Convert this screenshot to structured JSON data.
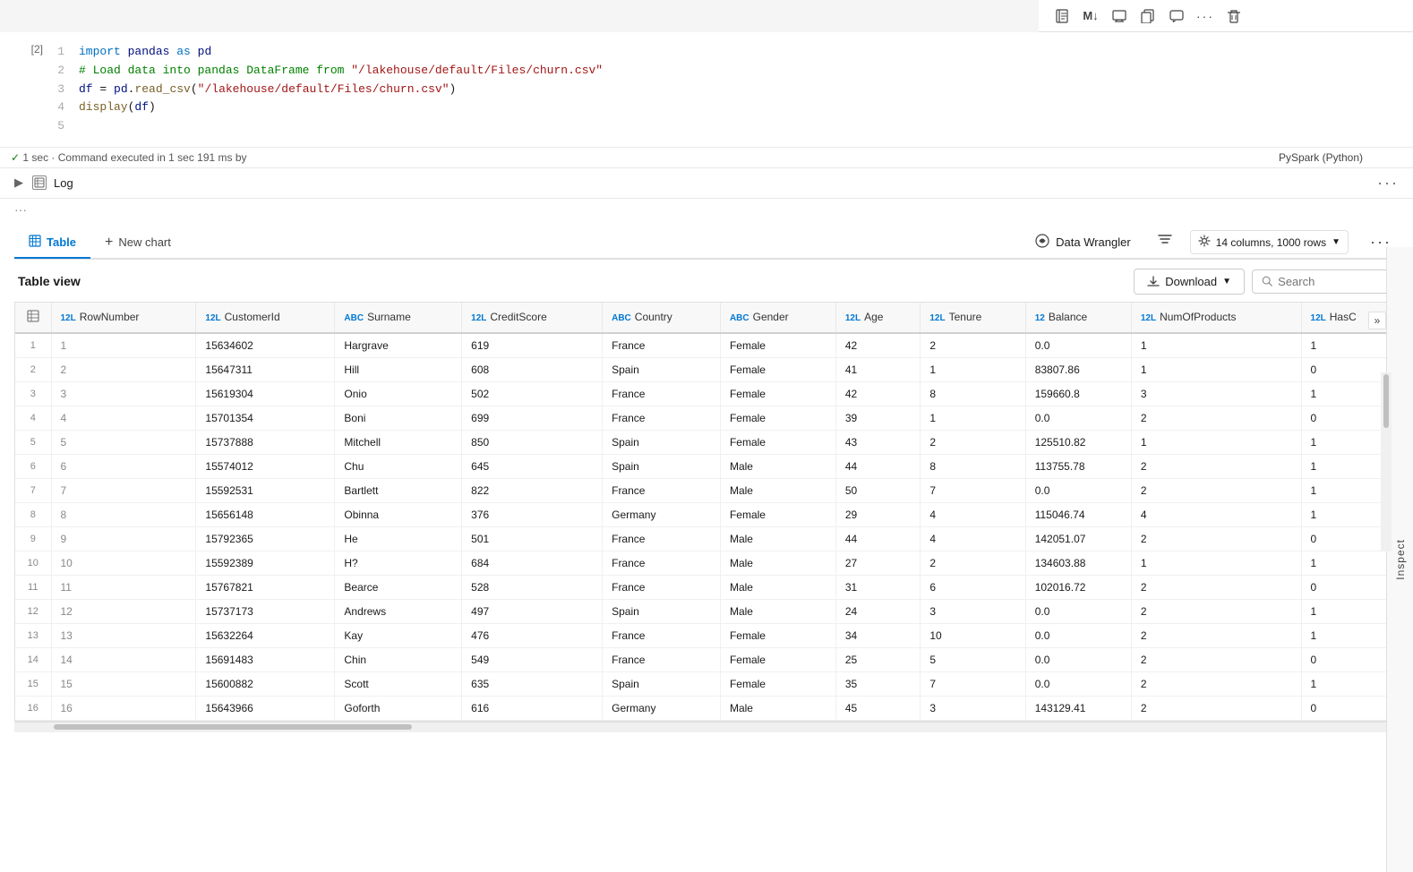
{
  "toolbar": {
    "buttons": [
      "notebook-icon",
      "markdown-icon",
      "screen-icon",
      "copy-icon",
      "comment-icon",
      "more-icon",
      "delete-icon"
    ]
  },
  "cell": {
    "exec_number": "[2]",
    "lines": [
      {
        "num": "1",
        "code": "import pandas as pd"
      },
      {
        "num": "2",
        "code": "# Load data into pandas DataFrame from \"/lakehouse/default/Files/churn.csv\""
      },
      {
        "num": "3",
        "code": "df = pd.read_csv(\"/lakehouse/default/Files/churn.csv\")"
      },
      {
        "num": "4",
        "code": "display(df)"
      },
      {
        "num": "5",
        "code": ""
      }
    ],
    "exec_status": "1 sec · Command executed in 1 sec 191 ms by",
    "exec_runtime": "PySpark (Python)"
  },
  "log": {
    "label": "Log"
  },
  "tabs": {
    "table_label": "Table",
    "new_chart_label": "New chart",
    "data_wrangler_label": "Data Wrangler",
    "col_config_label": "14 columns, 1000 rows",
    "table_view_title": "Table view",
    "download_label": "Download",
    "search_placeholder": "Search"
  },
  "table": {
    "columns": [
      {
        "type": "12L",
        "name": "RowNumber"
      },
      {
        "type": "12L",
        "name": "CustomerId"
      },
      {
        "type": "ABC",
        "name": "Surname"
      },
      {
        "type": "12L",
        "name": "CreditScore"
      },
      {
        "type": "ABC",
        "name": "Country"
      },
      {
        "type": "ABC",
        "name": "Gender"
      },
      {
        "type": "12L",
        "name": "Age"
      },
      {
        "type": "12L",
        "name": "Tenure"
      },
      {
        "type": "12",
        "name": "Balance"
      },
      {
        "type": "12L",
        "name": "NumOfProducts"
      },
      {
        "type": "12L",
        "name": "HasC"
      }
    ],
    "rows": [
      {
        "idx": 1,
        "row": [
          1,
          15634602,
          "Hargrave",
          619,
          "France",
          "Female",
          42,
          2,
          "0.0",
          1,
          1
        ]
      },
      {
        "idx": 2,
        "row": [
          2,
          15647311,
          "Hill",
          608,
          "Spain",
          "Female",
          41,
          1,
          "83807.86",
          1,
          0
        ]
      },
      {
        "idx": 3,
        "row": [
          3,
          15619304,
          "Onio",
          502,
          "France",
          "Female",
          42,
          8,
          "159660.8",
          3,
          1
        ]
      },
      {
        "idx": 4,
        "row": [
          4,
          15701354,
          "Boni",
          699,
          "France",
          "Female",
          39,
          1,
          "0.0",
          2,
          0
        ]
      },
      {
        "idx": 5,
        "row": [
          5,
          15737888,
          "Mitchell",
          850,
          "Spain",
          "Female",
          43,
          2,
          "125510.82",
          1,
          1
        ]
      },
      {
        "idx": 6,
        "row": [
          6,
          15574012,
          "Chu",
          645,
          "Spain",
          "Male",
          44,
          8,
          "113755.78",
          2,
          1
        ]
      },
      {
        "idx": 7,
        "row": [
          7,
          15592531,
          "Bartlett",
          822,
          "France",
          "Male",
          50,
          7,
          "0.0",
          2,
          1
        ]
      },
      {
        "idx": 8,
        "row": [
          8,
          15656148,
          "Obinna",
          376,
          "Germany",
          "Female",
          29,
          4,
          "115046.74",
          4,
          1
        ]
      },
      {
        "idx": 9,
        "row": [
          9,
          15792365,
          "He",
          501,
          "France",
          "Male",
          44,
          4,
          "142051.07",
          2,
          0
        ]
      },
      {
        "idx": 10,
        "row": [
          10,
          15592389,
          "H?",
          684,
          "France",
          "Male",
          27,
          2,
          "134603.88",
          1,
          1
        ]
      },
      {
        "idx": 11,
        "row": [
          11,
          15767821,
          "Bearce",
          528,
          "France",
          "Male",
          31,
          6,
          "102016.72",
          2,
          0
        ]
      },
      {
        "idx": 12,
        "row": [
          12,
          15737173,
          "Andrews",
          497,
          "Spain",
          "Male",
          24,
          3,
          "0.0",
          2,
          1
        ]
      },
      {
        "idx": 13,
        "row": [
          13,
          15632264,
          "Kay",
          476,
          "France",
          "Female",
          34,
          10,
          "0.0",
          2,
          1
        ]
      },
      {
        "idx": 14,
        "row": [
          14,
          15691483,
          "Chin",
          549,
          "France",
          "Female",
          25,
          5,
          "0.0",
          2,
          0
        ]
      },
      {
        "idx": 15,
        "row": [
          15,
          15600882,
          "Scott",
          635,
          "Spain",
          "Female",
          35,
          7,
          "0.0",
          2,
          1
        ]
      },
      {
        "idx": 16,
        "row": [
          16,
          15643966,
          "Goforth",
          616,
          "Germany",
          "Male",
          45,
          3,
          "143129.41",
          2,
          0
        ]
      }
    ]
  },
  "inspect": {
    "label": "Inspect"
  }
}
